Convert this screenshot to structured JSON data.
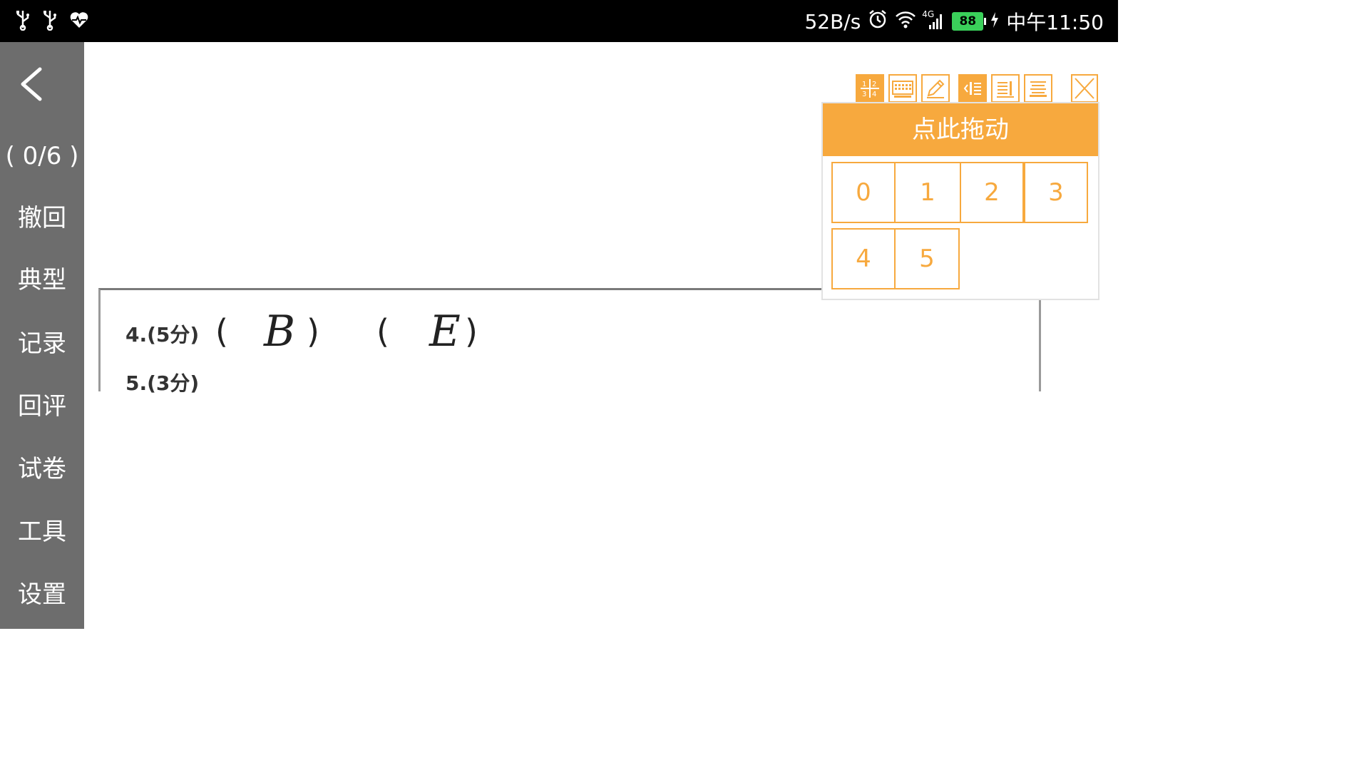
{
  "status_bar": {
    "network_speed": "52B/s",
    "network_type": "4G",
    "battery_level": "88",
    "time": "中午11:50",
    "left_icons": [
      "usb-icon",
      "usb-icon",
      "health-monitor-icon"
    ],
    "right_icons": [
      "alarm-icon",
      "wifi-icon",
      "signal-icon",
      "battery-icon",
      "charging-icon"
    ]
  },
  "sidebar": {
    "back_icon": "chevron-left-icon",
    "progress": "( 0/6 )",
    "items": [
      {
        "label": "撤回"
      },
      {
        "label": "典型"
      },
      {
        "label": "记录"
      },
      {
        "label": "回评"
      },
      {
        "label": "试卷"
      },
      {
        "label": "工具"
      },
      {
        "label": "设置"
      }
    ]
  },
  "paper": {
    "q4_label": "4.(5分)",
    "q4_answer1": "B",
    "q4_answer2": "E",
    "q5_label": "5.(3分)"
  },
  "score_panel": {
    "drag_label": "点此拖动",
    "scores": [
      "0",
      "1",
      "2",
      "3",
      "4",
      "5"
    ],
    "tool_icons": [
      "score-grid-icon",
      "keyboard-icon",
      "pencil-icon",
      "align-left-panel-icon",
      "align-right-panel-icon",
      "align-center-icon",
      "close-icon"
    ],
    "accent_color": "#f7a93e"
  }
}
